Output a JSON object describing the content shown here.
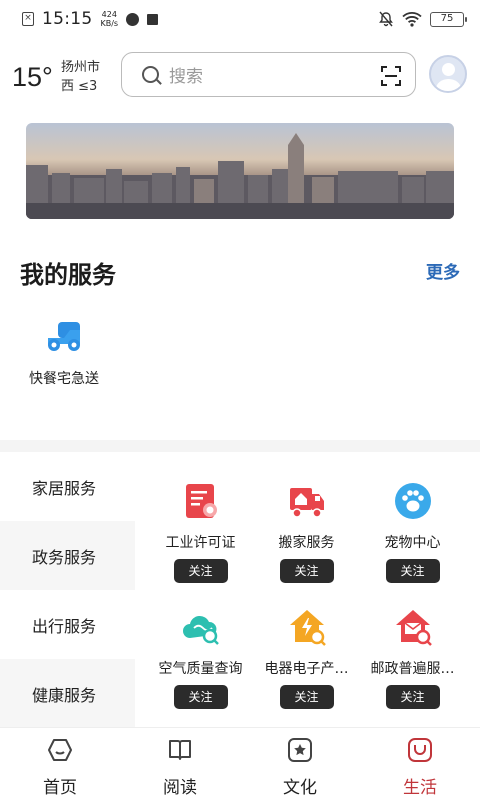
{
  "status_bar": {
    "time": "15:15",
    "net_speed_value": "424",
    "net_speed_unit": "KB/s",
    "battery": "75"
  },
  "header": {
    "temperature": "15°",
    "city": "扬州市",
    "wind": "西  ≤3",
    "search_placeholder": "搜索"
  },
  "my_services": {
    "title": "我的服务",
    "more": "更多",
    "items": [
      {
        "label": "快餐宅急送",
        "icon": "scooter-icon"
      }
    ]
  },
  "categories": [
    {
      "label": "家居服务"
    },
    {
      "label": "政务服务"
    },
    {
      "label": "出行服务"
    },
    {
      "label": "健康服务"
    }
  ],
  "service_grid": [
    {
      "label": "工业许可证",
      "button": "关注",
      "icon": "certificate-icon",
      "color": "#e8454b"
    },
    {
      "label": "搬家服务",
      "button": "关注",
      "icon": "moving-truck-icon",
      "color": "#e8454b"
    },
    {
      "label": "宠物中心",
      "button": "关注",
      "icon": "paw-icon",
      "color": "#3aa9ea"
    },
    {
      "label": "空气质量查询",
      "button": "关注",
      "icon": "cloud-search-icon",
      "color": "#2dbfb0"
    },
    {
      "label": "电器电子产…",
      "button": "关注",
      "icon": "power-house-icon",
      "color": "#f4a623"
    },
    {
      "label": "邮政普遍服…",
      "button": "关注",
      "icon": "mail-house-icon",
      "color": "#e8454b"
    }
  ],
  "bottom_nav": [
    {
      "label": "首页",
      "icon": "home-icon",
      "active": false
    },
    {
      "label": "阅读",
      "icon": "book-icon",
      "active": false
    },
    {
      "label": "文化",
      "icon": "star-icon",
      "active": false
    },
    {
      "label": "生活",
      "icon": "life-icon",
      "active": true
    }
  ],
  "colors": {
    "accent": "#c0353a",
    "link": "#2c6ab7",
    "button_bg": "#2b2b2b"
  }
}
